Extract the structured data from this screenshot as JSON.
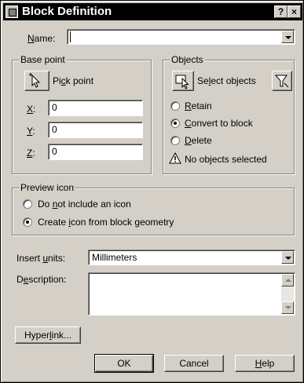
{
  "window": {
    "title": "Block Definition",
    "help_glyph": "?",
    "close_glyph": "×"
  },
  "name": {
    "label": "Name:",
    "underline": "N",
    "value": ""
  },
  "base_point": {
    "group_label": "Base point",
    "pick_label": "Pick point",
    "x": {
      "label": "X:",
      "value": "0"
    },
    "y": {
      "label": "Y:",
      "value": "0"
    },
    "z": {
      "label": "Z:",
      "value": "0"
    }
  },
  "objects": {
    "group_label": "Objects",
    "select_label": "Select objects",
    "options": [
      {
        "label": "Retain",
        "checked": false
      },
      {
        "label": "Convert to block",
        "checked": true
      },
      {
        "label": "Delete",
        "checked": false
      }
    ],
    "status": "No objects selected"
  },
  "preview": {
    "group_label": "Preview icon",
    "options": [
      {
        "label": "Do not include an icon",
        "checked": false
      },
      {
        "label": "Create icon from block geometry",
        "checked": true
      }
    ]
  },
  "insert_units": {
    "label": "Insert units:",
    "value": "Millimeters"
  },
  "description": {
    "label": "Description:",
    "value": ""
  },
  "buttons": {
    "hyperlink": "Hyperlink...",
    "ok": "OK",
    "cancel": "Cancel",
    "help": "Help"
  }
}
